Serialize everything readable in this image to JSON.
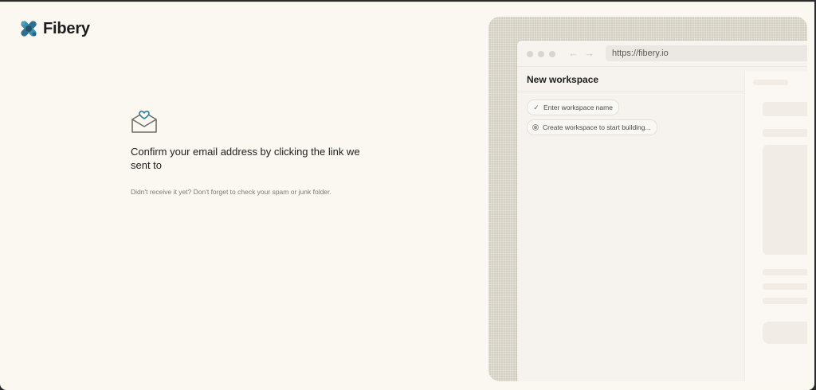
{
  "brand": {
    "name": "Fibery",
    "logo_icon": "fibery-logo-icon",
    "accent": "#2f7d9c"
  },
  "main": {
    "icon": "envelope-heart-icon",
    "headline": "Confirm your email address by clicking the link we sent to",
    "subtext": "Didn't receive it yet? Don't forget to check your spam or junk folder."
  },
  "preview": {
    "url": "https://fibery.io",
    "title": "New workspace",
    "steps": [
      {
        "label": "Enter workspace name",
        "icon": "check-icon",
        "state": "done"
      },
      {
        "label": "Create workspace to start building...",
        "icon": "radio-icon",
        "state": "current"
      }
    ]
  }
}
